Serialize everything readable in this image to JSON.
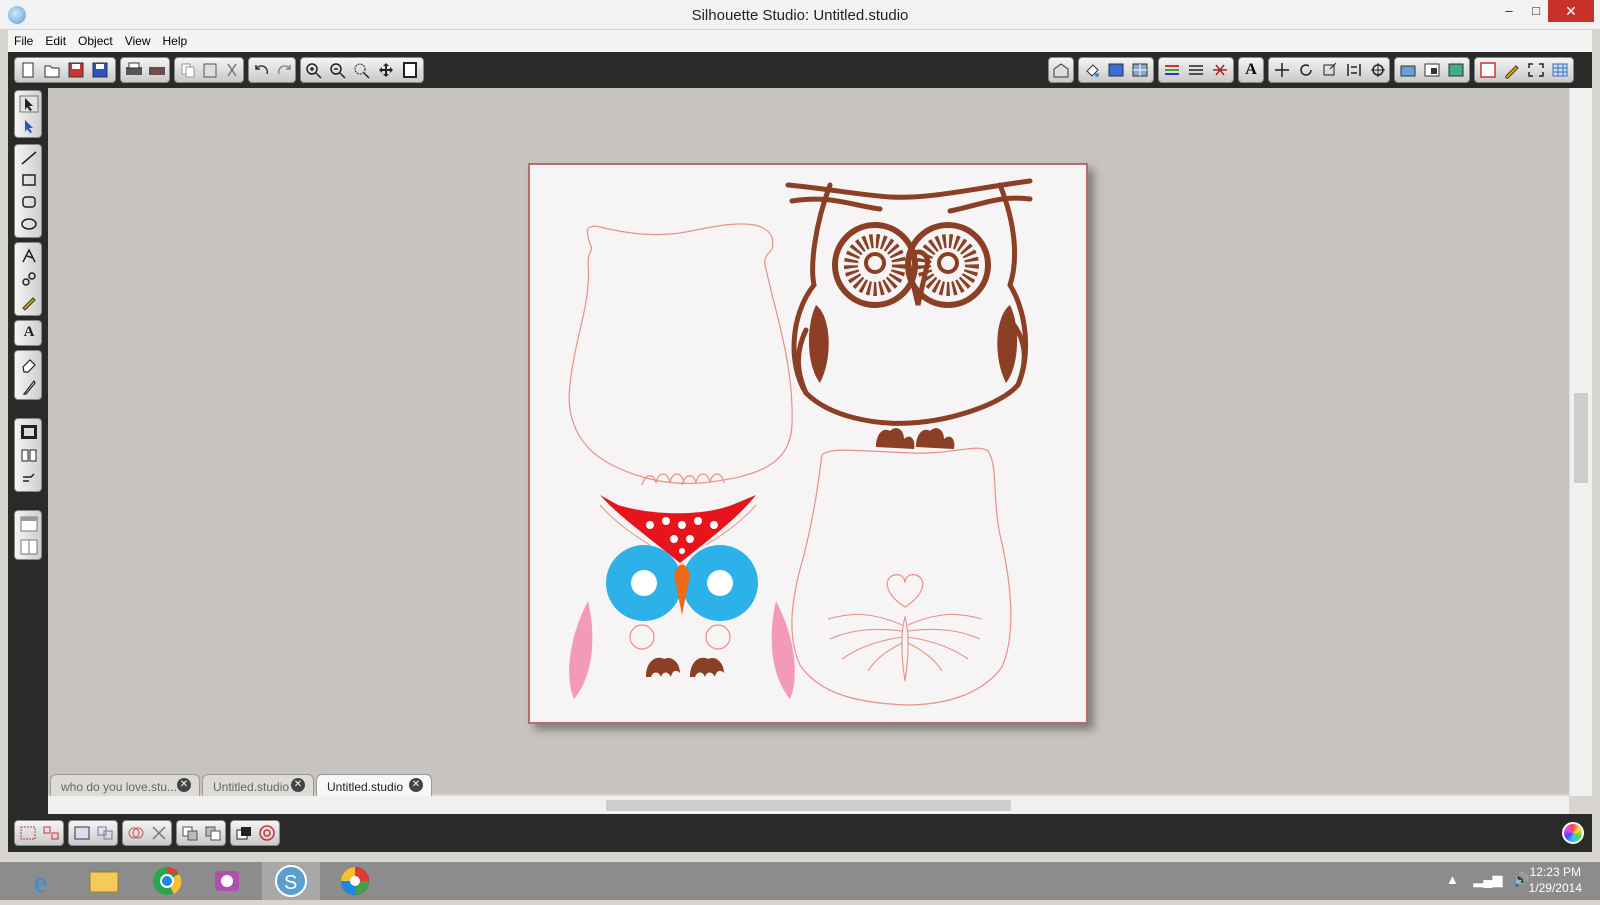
{
  "window": {
    "title": "Silhouette Studio: Untitled.studio",
    "minimize": "–",
    "maximize": "□",
    "close": "✕"
  },
  "menu": [
    "File",
    "Edit",
    "Object",
    "View",
    "Help"
  ],
  "toolbar": {
    "left_icons": [
      "new-icon",
      "open-icon",
      "save-icon",
      "save-library-icon",
      "print-icon",
      "print-cut-icon",
      "copy-icon",
      "paste-icon",
      "cut-icon",
      "undo-icon",
      "redo-icon",
      "zoom-in-icon",
      "zoom-out-icon",
      "zoom-select-icon",
      "pan-icon",
      "fit-page-icon"
    ],
    "right_icons": [
      "library-icon",
      "fill-color-icon",
      "fill-gradient-icon",
      "fill-pattern-icon",
      "line-color-icon",
      "line-style-icon",
      "cut-settings-icon",
      "text-style-icon",
      "move-icon",
      "rotate-icon",
      "scale-icon",
      "align-icon",
      "replicate-icon",
      "trace-icon",
      "offset-icon",
      "modify-icon",
      "page-settings-icon",
      "sketch-icon",
      "fullscreen-icon",
      "grid-icon"
    ]
  },
  "left_tools": [
    "select-icon",
    "edit-points-icon",
    "line-icon",
    "rectangle-icon",
    "rounded-rectangle-icon",
    "ellipse-icon",
    "polygon-icon",
    "curve-icon",
    "freehand-icon",
    "text-icon",
    "eraser-icon",
    "knife-icon",
    "page-view-icon",
    "library-panel-icon",
    "store-icon",
    "panel-1-icon",
    "panel-2-icon"
  ],
  "tabs": [
    {
      "label": "who do you love.stu..."
    },
    {
      "label": "Untitled.studio"
    },
    {
      "label": "Untitled.studio",
      "active": true
    }
  ],
  "bottom_tools": [
    "group-icon",
    "ungroup-icon",
    "make-compound-icon",
    "release-compound-icon",
    "weld-icon",
    "delete-icon",
    "duplicate-icon",
    "mirror-icon",
    "bring-front-icon",
    "offset-tool-icon"
  ],
  "taskbar": {
    "apps": [
      "internet-explorer-icon",
      "file-explorer-icon",
      "chrome-icon",
      "media-app-icon",
      "silhouette-studio-icon",
      "picasa-icon"
    ],
    "time": "12:23 PM",
    "date": "1/29/2014"
  },
  "colors": {
    "owl_brown": "#8b3f24",
    "red": "#e8141c",
    "blue": "#2cb1e8",
    "orange": "#ef6a15",
    "pink": "#f29ab8",
    "outline": "#e8908a",
    "toolbar_bg": "#2a2a2a"
  }
}
